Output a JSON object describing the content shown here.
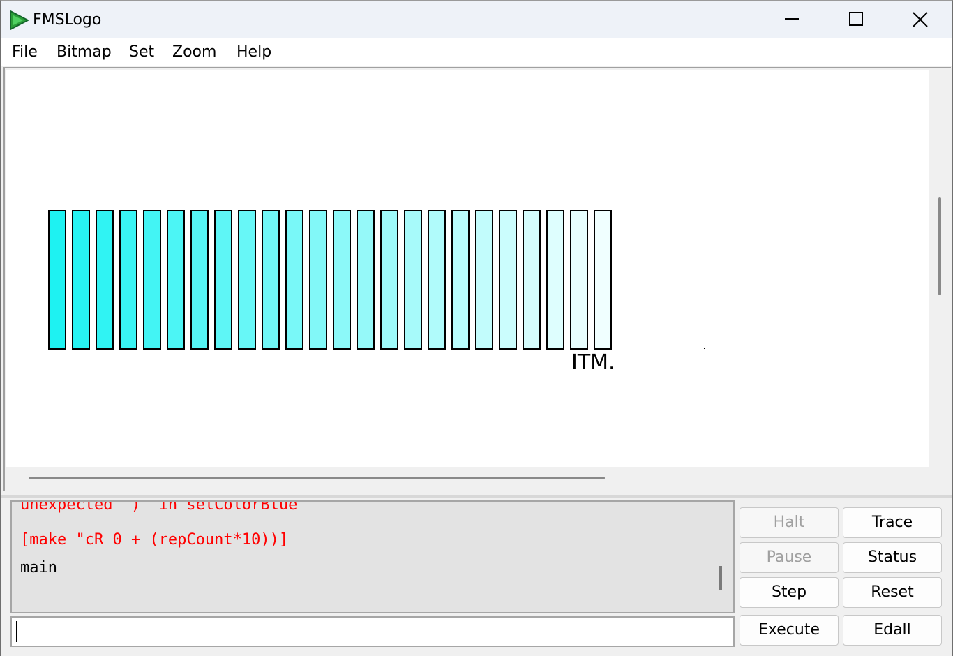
{
  "window": {
    "title": "FMSLogo",
    "icon": "fmslogo-play-icon",
    "controls": [
      "minimize-icon",
      "maximize-icon",
      "close-icon"
    ]
  },
  "menu": {
    "items": [
      "File",
      "Bitmap",
      "Set",
      "Zoom",
      "Help"
    ]
  },
  "canvas": {
    "bar_count": 24,
    "bar_color_start": "#1ef2f2",
    "bar_color_end": "#f0ffff",
    "outline_color": "#000000",
    "label": "ITM."
  },
  "commander": {
    "output_lines": [
      {
        "text": "unexpected ')' in setColorBlue",
        "color": "#ff0000"
      },
      {
        "text": "[make \"cR 0 + (repCount*10))]",
        "color": "#ff0000"
      },
      {
        "text": "main",
        "color": "#000000"
      }
    ],
    "input_value": "",
    "buttons": {
      "halt": "Halt",
      "trace": "Trace",
      "pause": "Pause",
      "status": "Status",
      "step": "Step",
      "reset": "Reset",
      "execute": "Execute",
      "edall": "Edall"
    }
  }
}
